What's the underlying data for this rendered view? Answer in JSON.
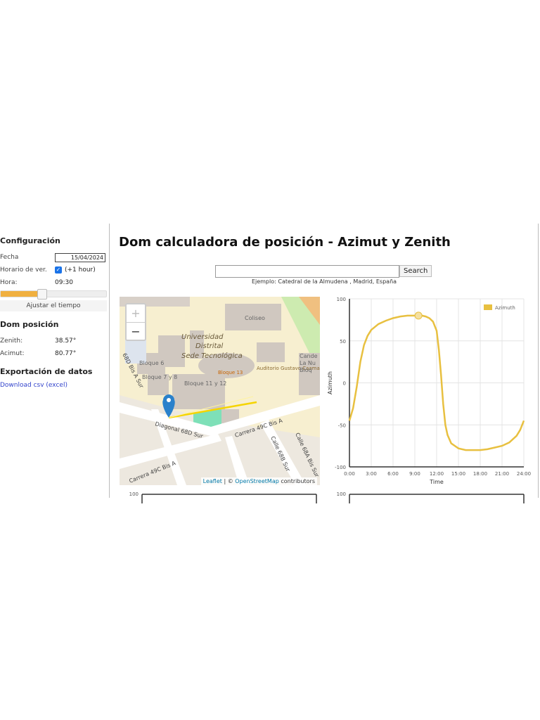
{
  "sidebar": {
    "config_title": "Configuración",
    "fecha_label": "Fecha",
    "fecha_value": "15/04/2024",
    "horario_label": "Horario de ver.",
    "horario_checked": true,
    "horario_note": "(+1 hour)",
    "hora_label": "Hora:",
    "hora_value": "09:30",
    "time_slider_percent": 40,
    "adjust_button": "Ajustar el tiempo",
    "pos_title": "Dom posición",
    "zenith_label": "Zenith:",
    "zenith_value": "38.57°",
    "azimut_label": "Acimut:",
    "azimut_value": "80.77°",
    "export_title": "Exportación de datos",
    "download_link": "Download csv (excel)"
  },
  "header": {
    "title": "Dom calculadora de posición - Azimut y Zenith"
  },
  "search": {
    "placeholder": "",
    "value": "",
    "button": "Search",
    "example": "Ejemplo: Catedral de la Almudena , Madrid, España"
  },
  "map": {
    "zoom_in": "+",
    "zoom_out": "−",
    "labels": [
      "Coliseo",
      "Universidad",
      "Distrital",
      "Sede Tecnológica",
      "Bloque 6",
      "Bloque 7 y 8",
      "Bloque 11 y 12",
      "Bloque 13",
      "Auditorio Gustavo Caamaño",
      "Diagonal 68D Sur",
      "Carrera 49C Bis A",
      "Calle 68B Sur",
      "Calle 68A Bis Sur",
      "Carrera 49C Bis A",
      "68D Bis A Sur",
      "Cande La Nu Bloq"
    ],
    "attribution_leaflet": "Leaflet",
    "attribution_sep": " | © ",
    "attribution_osm": "OpenStreetMap",
    "attribution_rest": " contributors",
    "accent": "#f5d400",
    "marker_color": "#2a81cb"
  },
  "chart_data": [
    {
      "type": "line",
      "xlabel": "Time",
      "ylabel": "Azimuth",
      "ylim": [
        -100,
        100
      ],
      "xlim": [
        0,
        24
      ],
      "yticks": [
        "100",
        "50",
        "0",
        "-50",
        "-100"
      ],
      "xticks": [
        "0:00",
        "3:00",
        "6:00",
        "9:00",
        "12:00",
        "15:00",
        "18:00",
        "21:00",
        "24:00"
      ],
      "grid": true,
      "legend": "top-right",
      "series": [
        {
          "name": "Azimuth",
          "color": "#e8c040",
          "x": [
            0,
            0.5,
            1,
            1.5,
            2,
            2.5,
            3,
            4,
            5,
            6,
            7,
            8,
            9,
            10,
            10.5,
            11,
            11.5,
            12,
            12.3,
            12.6,
            12.9,
            13.2,
            13.5,
            14,
            15,
            16,
            17,
            18,
            19,
            20,
            21,
            22,
            23,
            23.5,
            24
          ],
          "y": [
            -45,
            -30,
            -5,
            25,
            45,
            56,
            63,
            70,
            74,
            77,
            79,
            80,
            80,
            80,
            79,
            77,
            73,
            62,
            40,
            10,
            -25,
            -50,
            -62,
            -72,
            -78,
            -80,
            -80,
            -80,
            -79,
            -77,
            -75,
            -71,
            -63,
            -56,
            -45
          ]
        }
      ],
      "current_point": {
        "x": 9.5,
        "y": 80
      }
    },
    {
      "type": "line",
      "yticks": [
        "100"
      ]
    },
    {
      "type": "line",
      "yticks": [
        "100"
      ]
    }
  ]
}
